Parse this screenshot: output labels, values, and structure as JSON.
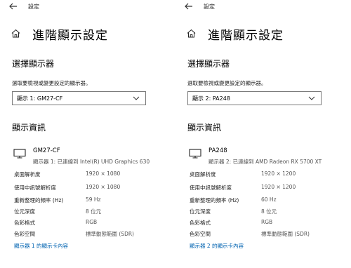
{
  "panes": [
    {
      "window_title": "設定",
      "page_title": "進階顯示設定",
      "select_section_title": "選擇顯示器",
      "select_hint": "選取要檢視或變更設定的顯示器。",
      "dropdown_value": "顯示 1: GM27-CF",
      "info_section_title": "顯示資訊",
      "monitor_name": "GM27-CF",
      "monitor_connection": "顯示器 1: 已連線到 Intel(R) UHD Graphics 630",
      "info_rows": [
        {
          "label": "桌面解析度",
          "value": "1920 × 1080"
        },
        {
          "label": "使用中訊號解析度",
          "value": "1920 × 1080"
        },
        {
          "label": "重新整理的頻率 (Hz)",
          "value": "59 Hz"
        },
        {
          "label": "位元深度",
          "value": "8 位元"
        },
        {
          "label": "色彩格式",
          "value": "RGB"
        },
        {
          "label": "色彩空間",
          "value": "標準動態範圍 (SDR)"
        }
      ],
      "adapter_link": "顯示器 1 的顯示卡內容"
    },
    {
      "window_title": "設定",
      "page_title": "進階顯示設定",
      "select_section_title": "選擇顯示器",
      "select_hint": "選取要檢視或變更設定的顯示器。",
      "dropdown_value": "顯示 2: PA248",
      "info_section_title": "顯示資訊",
      "monitor_name": "PA248",
      "monitor_connection": "顯示器 2: 已連線到 AMD Radeon RX 5700 XT",
      "info_rows": [
        {
          "label": "桌面解析度",
          "value": "1920 × 1200"
        },
        {
          "label": "使用中訊號解析度",
          "value": "1920 × 1200"
        },
        {
          "label": "重新整理的頻率 (Hz)",
          "value": "60 Hz"
        },
        {
          "label": "位元深度",
          "value": "8 位元"
        },
        {
          "label": "色彩格式",
          "value": "RGB"
        },
        {
          "label": "色彩空間",
          "value": "標準動態範圍 (SDR)"
        }
      ],
      "adapter_link": "顯示器 2 的顯示卡內容"
    }
  ]
}
